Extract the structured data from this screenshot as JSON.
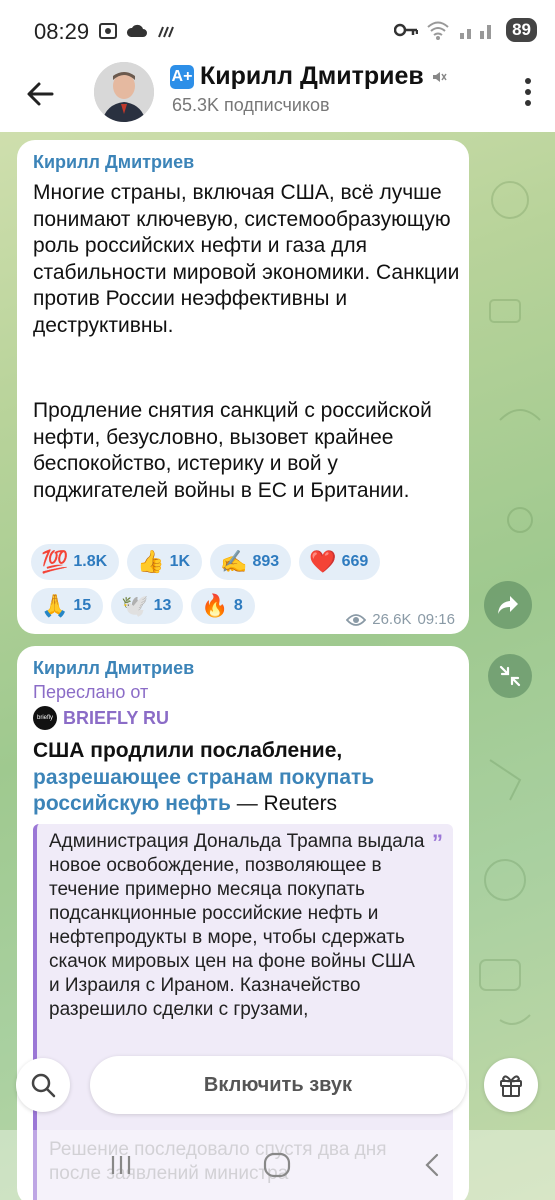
{
  "status_bar": {
    "time": "08:29",
    "battery": "89",
    "icons": [
      "screenshot-icon",
      "cloud-icon",
      "wifi-off-icon",
      "key-icon",
      "wifi-icon",
      "signal-icon"
    ]
  },
  "header": {
    "title": "Кирилл Дмитриев",
    "subtitle": "65.3K подписчиков",
    "badge": "A+"
  },
  "message1": {
    "author": "Кирилл Дмитриев",
    "paragraph1": "Многие страны, включая США, всё лучше понимают ключевую, системообразующую роль российских нефти и газа для стабильности мировой экономики. Санкции против России неэффективны и деструктивны.",
    "paragraph2": "Продление снятия санкций с российской нефти, безусловно, вызовет крайнее беспокойство, истерику и вой у поджигателей войны в ЕС и Британии.",
    "reactions": [
      {
        "emoji": "💯",
        "count": "1.8K"
      },
      {
        "emoji": "👍",
        "count": "1K"
      },
      {
        "emoji": "✍️",
        "count": "893"
      },
      {
        "emoji": "❤️",
        "count": "669"
      },
      {
        "emoji": "🙏",
        "count": "15"
      },
      {
        "emoji": "🕊️",
        "count": "13"
      },
      {
        "emoji": "🔥",
        "count": "8"
      }
    ],
    "views": "26.6K",
    "time": "09:16"
  },
  "message2": {
    "author": "Кирилл Дмитриев",
    "forwarded_label": "Переслано от",
    "source_name": "BRIEFLY RU",
    "source_logo_text": "briefly",
    "headline_bold": "США продлили послабление, ",
    "headline_link": "разрешающее странам покупать российскую нефть",
    "headline_tail": " — Reuters",
    "quote_text": "Администрация Дональда Трампа выдала новое освобождение, позволяющее в течение примерно месяца покупать подсанкционные российские нефть и нефтепродукты в море, чтобы сдержать скачок мировых цен на фоне войны США и Израиля с Ираном. Казначейство разрешило сделки с грузами,",
    "quote_more": "Решение последовало спустя два дня после заявлений министра"
  },
  "bottom": {
    "unmute_label": "Включить звук"
  },
  "colors": {
    "accent": "#3c84b8",
    "forward": "#8b6cc7",
    "reaction_bg": "#e4eef8"
  }
}
